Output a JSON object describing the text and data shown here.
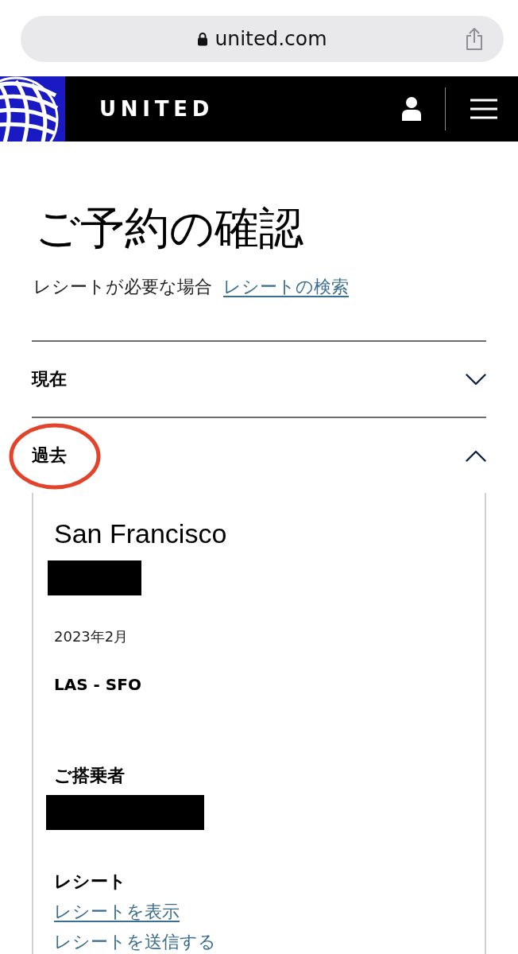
{
  "browser": {
    "url": "united.com"
  },
  "header": {
    "logo_text": "UNITED"
  },
  "page": {
    "title": "ご予約の確認",
    "receipt_prompt": "レシートが必要な場合",
    "receipt_search_link": "レシートの検索"
  },
  "sections": [
    {
      "label": "現在",
      "expanded": false,
      "circled": false
    },
    {
      "label": "過去",
      "expanded": true,
      "circled": true
    }
  ],
  "trip": {
    "destination": "San Francisco",
    "destination_detail_redacted": true,
    "date": "2023年2月",
    "route": "LAS - SFO",
    "passengers_label": "ご搭乗者",
    "passenger_redacted": true,
    "receipt_label": "レシート",
    "receipt_links": [
      {
        "label": "レシートを表示",
        "underlined": true
      },
      {
        "label": "レシートを送信する",
        "underlined": false
      }
    ]
  }
}
